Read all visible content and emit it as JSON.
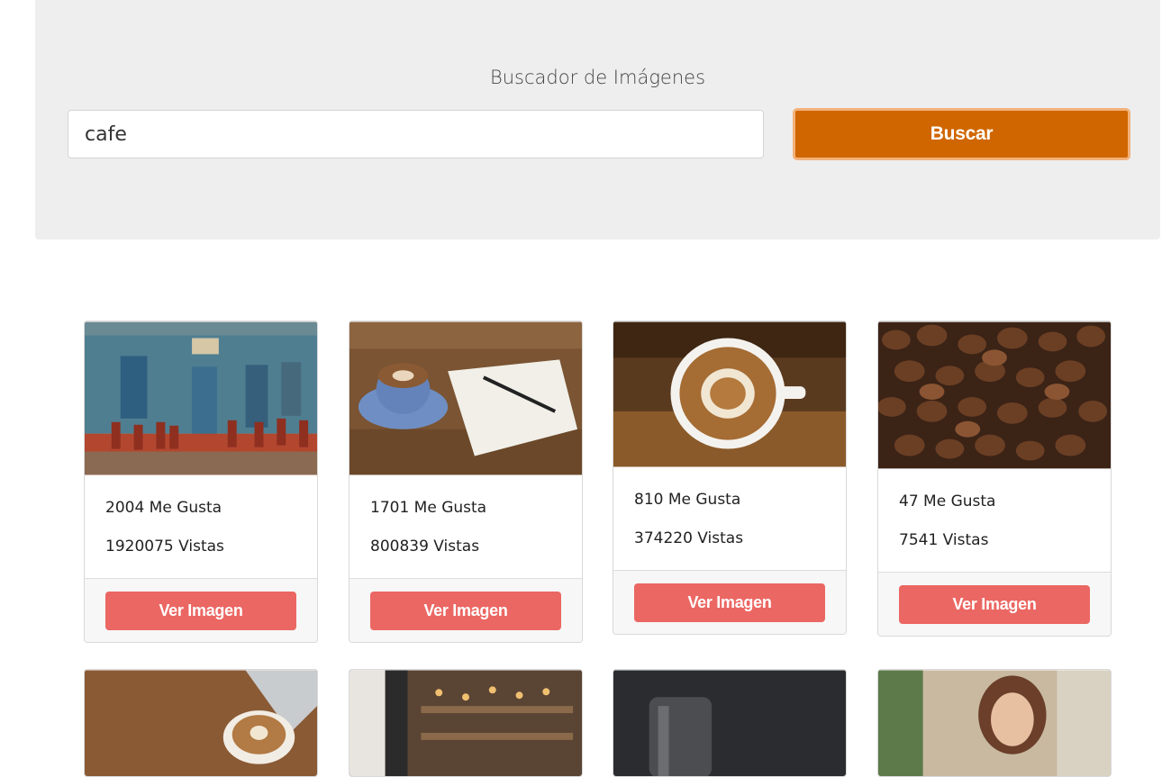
{
  "search": {
    "title": "Buscador de Imágenes",
    "value": "cafe",
    "button_label": "Buscar"
  },
  "cards": [
    {
      "likes": "2004 Me Gusta",
      "views": "1920075 Vistas",
      "button_label": "Ver Imagen"
    },
    {
      "likes": "1701 Me Gusta",
      "views": "800839 Vistas",
      "button_label": "Ver Imagen"
    },
    {
      "likes": "810 Me Gusta",
      "views": "374220 Vistas",
      "button_label": "Ver Imagen"
    },
    {
      "likes": "47 Me Gusta",
      "views": "7541 Vistas",
      "button_label": "Ver Imagen"
    }
  ],
  "colors": {
    "search_button": "#d06600",
    "card_button": "#eb6763",
    "jumbotron_bg": "#eeeeee"
  }
}
